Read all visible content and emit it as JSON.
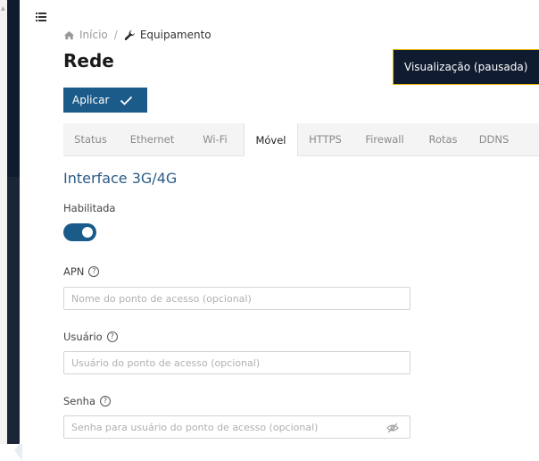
{
  "breadcrumb": {
    "home_label": "Início",
    "separator": "/",
    "current_label": "Equipamento"
  },
  "page": {
    "title": "Rede"
  },
  "toolbar": {
    "apply_label": "Aplicar"
  },
  "tabs": [
    {
      "label": "Status",
      "active": false
    },
    {
      "label": "Ethernet",
      "active": false
    },
    {
      "label": "Wi-Fi",
      "active": false
    },
    {
      "label": "Móvel",
      "active": true
    },
    {
      "label": "HTTPS",
      "active": false
    },
    {
      "label": "Firewall",
      "active": false
    },
    {
      "label": "Rotas",
      "active": false
    },
    {
      "label": "DDNS",
      "active": false
    }
  ],
  "section": {
    "title": "Interface 3G/4G"
  },
  "form": {
    "enabled": {
      "label": "Habilitada",
      "value": true
    },
    "apn": {
      "label": "APN",
      "value": "",
      "placeholder": "Nome do ponto de acesso (opcional)"
    },
    "user": {
      "label": "Usuário",
      "value": "",
      "placeholder": "Usuário do ponto de acesso (opcional)"
    },
    "password": {
      "label": "Senha",
      "value": "",
      "placeholder": "Senha para usuário do ponto de acesso (opcional)"
    }
  },
  "tooltip": {
    "text": "Visualização (pausada)"
  },
  "colors": {
    "sidebar_bg": "#0f1b2e",
    "primary": "#1b5b8a",
    "section_title": "#2b5a86",
    "tooltip_border": "#e8b300"
  },
  "icons": {
    "menu": "menu-icon",
    "home": "home-icon",
    "wrench": "wrench-icon",
    "check": "check-icon",
    "help": "help-circle-icon",
    "eye_off": "eye-off-icon",
    "collapse": "chevron-left-icon"
  }
}
